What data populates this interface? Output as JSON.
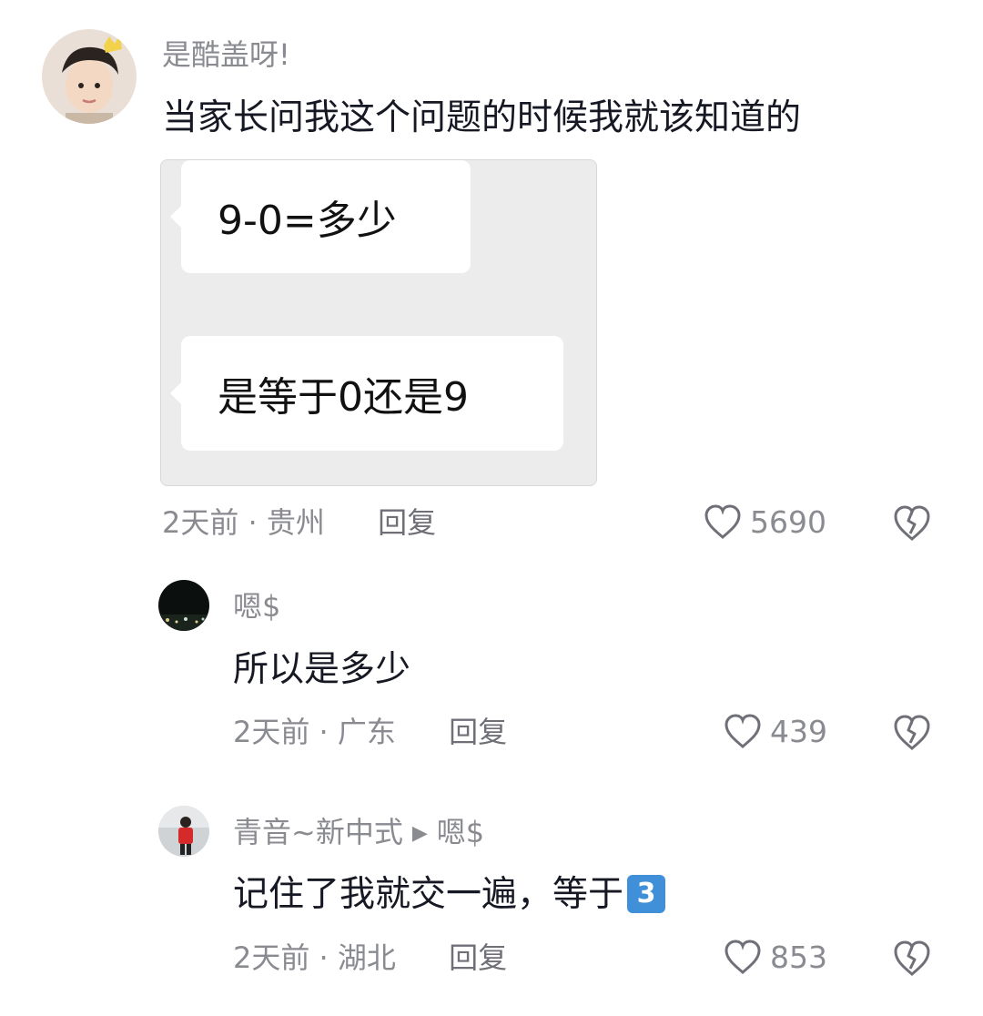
{
  "comments": [
    {
      "username": "是酷盖呀!",
      "text": "当家长问我这个问题的时候我就该知道的",
      "image_bubbles": [
        "9-0=多少",
        "是等于0还是9"
      ],
      "time": "2天前",
      "location": "贵州",
      "reply_label": "回复",
      "likes": "5690",
      "avatar": "avatar-photo-boy-with-crown"
    },
    {
      "username": "嗯$",
      "text": "所以是多少",
      "time": "2天前",
      "location": "广东",
      "reply_label": "回复",
      "likes": "439",
      "avatar": "avatar-night-city"
    },
    {
      "username": "青音~新中式",
      "reply_to": "嗯$",
      "text": "记住了我就交一遍，等于",
      "emoji": "3️⃣",
      "time": "2天前",
      "location": "湖北",
      "reply_label": "回复",
      "likes": "853",
      "avatar": "avatar-person-red-jacket"
    }
  ],
  "separator": " · ",
  "colors": {
    "text": "#161823",
    "meta": "#8a8b91",
    "keycap": "#3f8fd9"
  }
}
